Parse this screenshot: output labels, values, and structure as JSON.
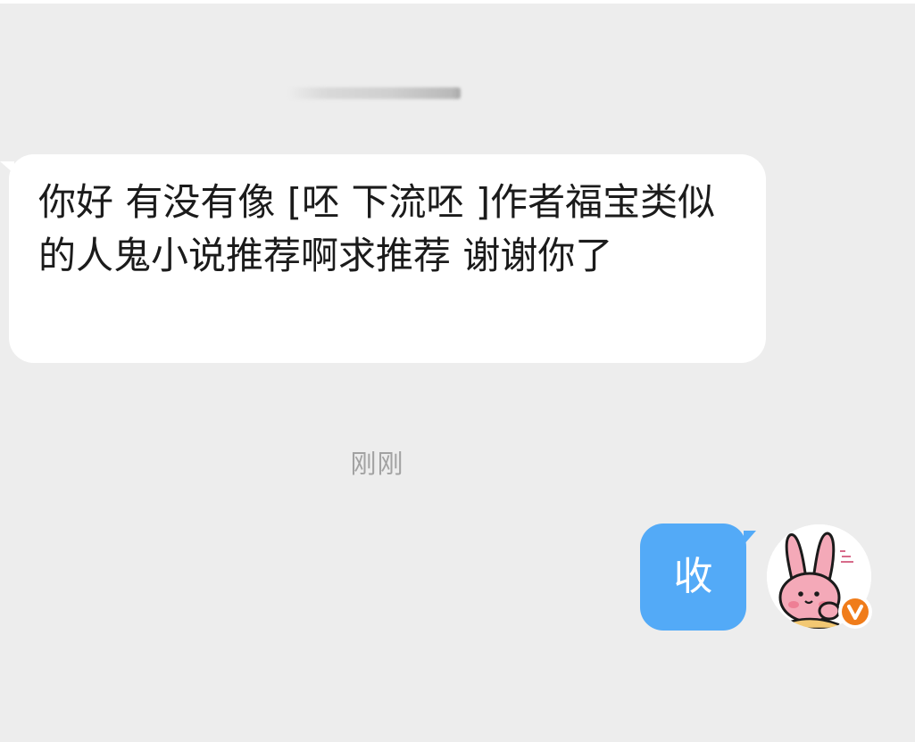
{
  "chat": {
    "contact_name_blurred": "",
    "messages": [
      {
        "direction": "incoming",
        "text": "你好 有没有像 [呸 下流呸 ]作者福宝类似的人鬼小说推荐啊求推荐 谢谢你了"
      },
      {
        "direction": "outgoing",
        "text": "收"
      }
    ],
    "timestamp": "刚刚"
  },
  "avatar": {
    "icon": "pink-bunny-avatar-icon",
    "badge_icon": "verified-v-badge-icon",
    "badge_text": "V"
  },
  "colors": {
    "background": "#ededed",
    "incoming_bubble": "#ffffff",
    "outgoing_bubble": "#53aaf7",
    "timestamp_text": "#a2a2a2",
    "badge": "#f07c1a"
  }
}
